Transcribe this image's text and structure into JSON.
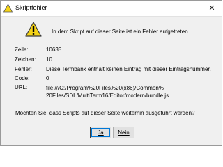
{
  "window": {
    "title": "Skriptfehler",
    "close_glyph": "✕"
  },
  "header": {
    "message": "In dem Skript auf dieser Seite ist ein Fehler aufgetreten."
  },
  "details": {
    "line_label": "Zeile:",
    "line_value": "10635",
    "char_label": "Zeichen:",
    "char_value": "10",
    "error_label": "Fehler:",
    "error_value": "Diese Termbank enthält keinen Eintrag mit dieser Eintragsnummer.",
    "code_label": "Code:",
    "code_value": "0",
    "url_label": "URL:",
    "url_line1": "file:///C:/Program%20Files%20(x86)/Common%",
    "url_line2": "20Files/SDL/MultiTerm16/Editor/modern/bundle.js"
  },
  "question": "Möchten Sie, dass Scripts auf dieser Seite weiterhin ausgeführt werden?",
  "buttons": {
    "yes_label": "Ja",
    "no_label": "Nein"
  },
  "colors": {
    "warning_fill": "#f5d316",
    "warning_stroke": "#3a3a3a",
    "focus_outline": "#0078d7"
  }
}
